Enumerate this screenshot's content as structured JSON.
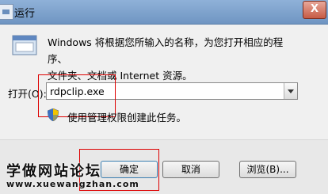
{
  "window": {
    "title": "运行",
    "close_label": "X"
  },
  "description": {
    "line1": "Windows 将根据您所输入的名称，为您打开相应的程序、",
    "line2": "文件夹、文档或 Internet 资源。"
  },
  "open_field": {
    "label": "打开(O):",
    "value": "rdpclip.exe"
  },
  "admin_note": "使用管理权限创建此任务。",
  "buttons": {
    "ok": "确定",
    "cancel": "取消",
    "browse": "浏览(B)..."
  },
  "watermark": {
    "title": "学做网站论坛",
    "url": "www.xuewangzhan.com"
  },
  "colors": {
    "highlight": "#dd0000",
    "titlebar": "#7fa3cf"
  }
}
